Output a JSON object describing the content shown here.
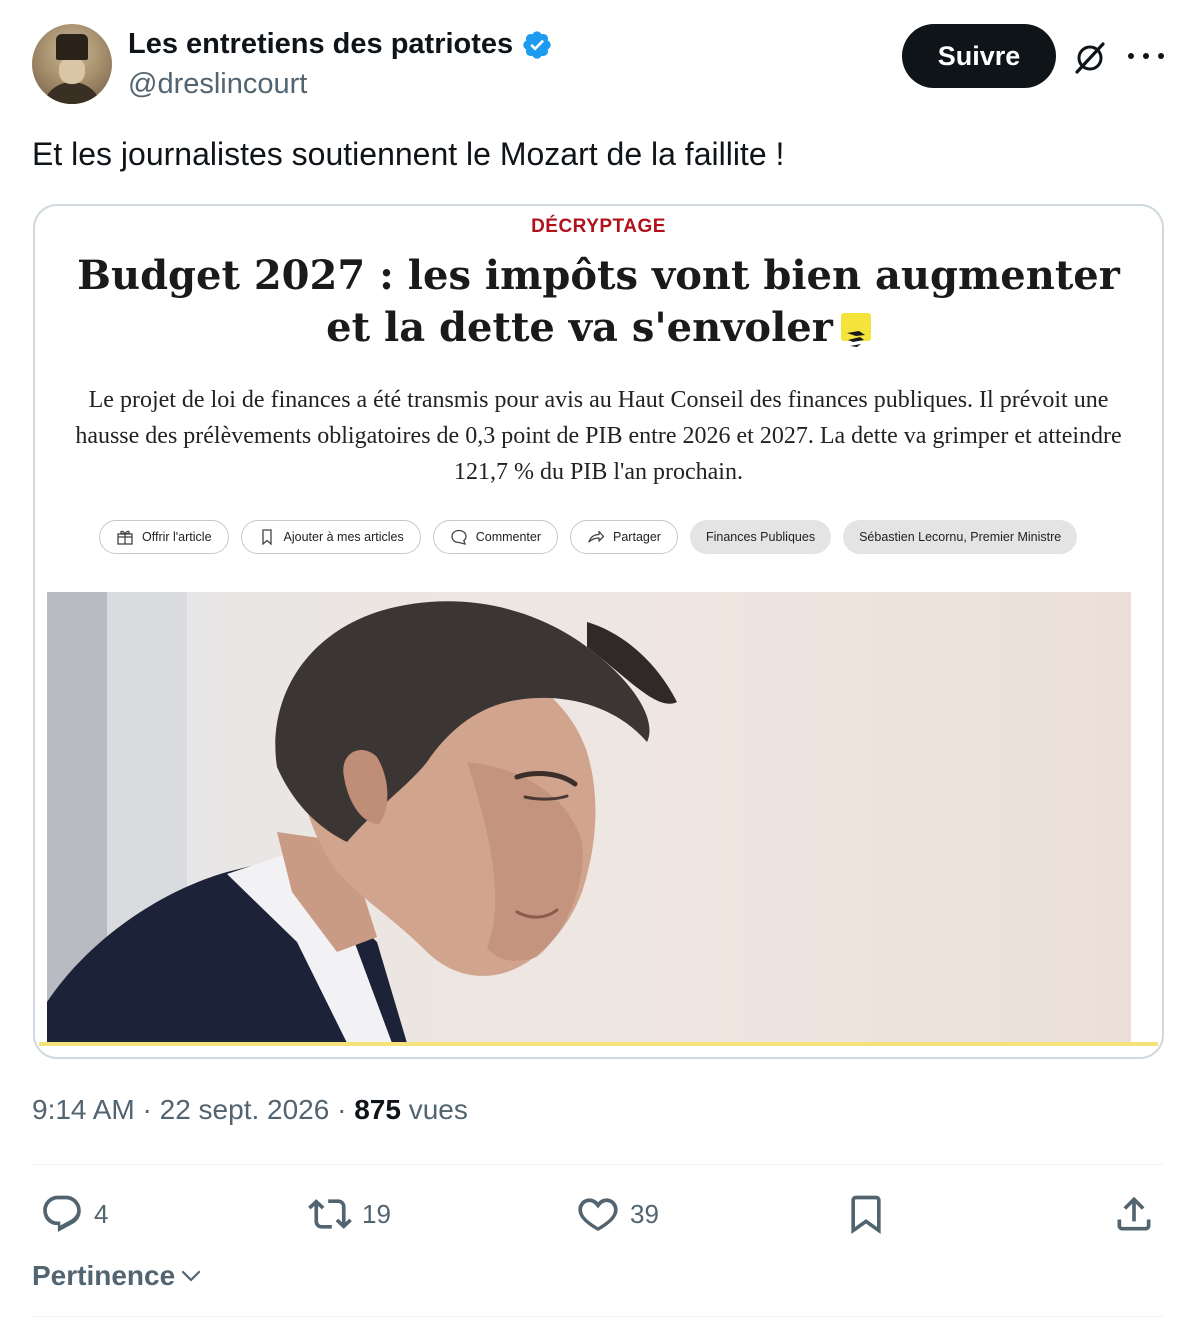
{
  "author": {
    "display_name": "Les entretiens des patriotes",
    "handle": "@dreslincourt",
    "verified": true,
    "verified_color": "#1d9bf0"
  },
  "header": {
    "follow_label": "Suivre",
    "grok_icon": "grok-slash-icon",
    "more_icon": "more-dots-icon"
  },
  "tweet": {
    "text": "Et les journalistes soutiennent le Mozart de la faillite !"
  },
  "card": {
    "kicker": "DÉCRYPTAGE",
    "kicker_color": "#b0111b",
    "headline": "Budget 2027 : les impôts vont bien augmenter et la dette va s'envoler",
    "lede": "Le projet de loi de finances a été transmis pour avis au Haut Conseil des finances publiques. Il prévoit une hausse des prélèvements obligatoires de 0,3 point de PIB entre 2026 et 2027. La dette va grimper et atteindre 121,7 % du PIB l'an prochain.",
    "actions": [
      {
        "label": "Offrir l'article",
        "icon": "gift-icon"
      },
      {
        "label": "Ajouter à mes articles",
        "icon": "bookmark-icon"
      },
      {
        "label": "Commenter",
        "icon": "comment-icon"
      },
      {
        "label": "Partager",
        "icon": "share-arrow-icon"
      }
    ],
    "tags": [
      "Finances Publiques",
      "Sébastien Lecornu, Premier Ministre"
    ]
  },
  "meta": {
    "time": "9:14 AM",
    "date": "22 sept. 2026",
    "views_count": "875",
    "views_label": "vues"
  },
  "stats": {
    "replies": "4",
    "reposts": "19",
    "likes": "39"
  },
  "sort": {
    "label": "Pertinence"
  }
}
